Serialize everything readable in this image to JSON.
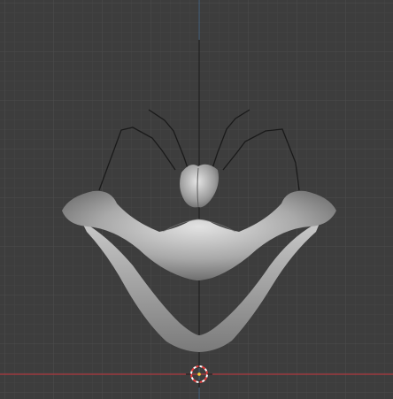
{
  "viewport": {
    "background": "#3d3d3d",
    "grid_minor_color": "#444444",
    "grid_major_color": "#4a4a4a",
    "x_axis_color": "#b0383f",
    "z_axis_color": "#3e8ad6",
    "curve_color": "#1a1a1a",
    "mesh_color": "#b3b3b3",
    "cursor_icon": "3d-cursor-icon",
    "cursor_ring_colors": [
      "#e23c3c",
      "#ffffff"
    ]
  }
}
